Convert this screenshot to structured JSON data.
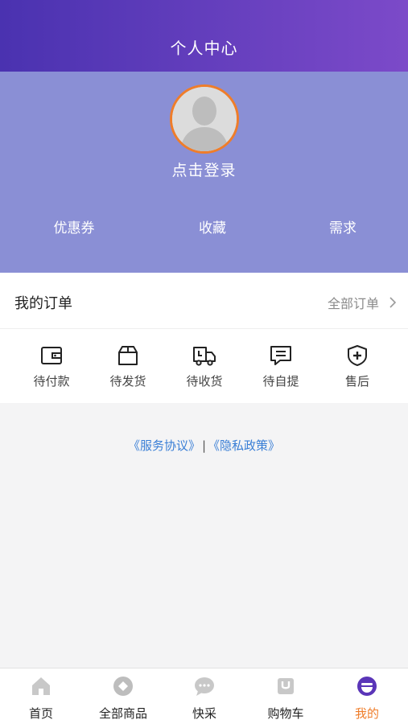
{
  "header": {
    "title": "个人中心"
  },
  "profile": {
    "login_text": "点击登录",
    "stats": {
      "coupon": "优惠券",
      "favorite": "收藏",
      "demand": "需求"
    }
  },
  "orders": {
    "title": "我的订单",
    "all_label": "全部订单",
    "items": [
      {
        "label": "待付款",
        "icon": "wallet-icon"
      },
      {
        "label": "待发货",
        "icon": "box-icon"
      },
      {
        "label": "待收货",
        "icon": "truck-icon"
      },
      {
        "label": "待自提",
        "icon": "message-icon"
      },
      {
        "label": "售后",
        "icon": "shield-plus-icon"
      }
    ]
  },
  "legal": {
    "service": "《服务协议》",
    "separator": "|",
    "privacy": "《隐私政策》"
  },
  "tabbar": {
    "items": [
      {
        "label": "首页",
        "icon": "home-icon"
      },
      {
        "label": "全部商品",
        "icon": "category-icon"
      },
      {
        "label": "快采",
        "icon": "chat-icon"
      },
      {
        "label": "购物车",
        "icon": "cart-icon"
      },
      {
        "label": "我的",
        "icon": "profile-icon",
        "active": true
      }
    ]
  },
  "colors": {
    "header_start": "#4a32b0",
    "header_end": "#7c4ac9",
    "profile_bg": "#8a8fd5",
    "accent": "#ef7d2a",
    "link": "#3a7fd6"
  }
}
